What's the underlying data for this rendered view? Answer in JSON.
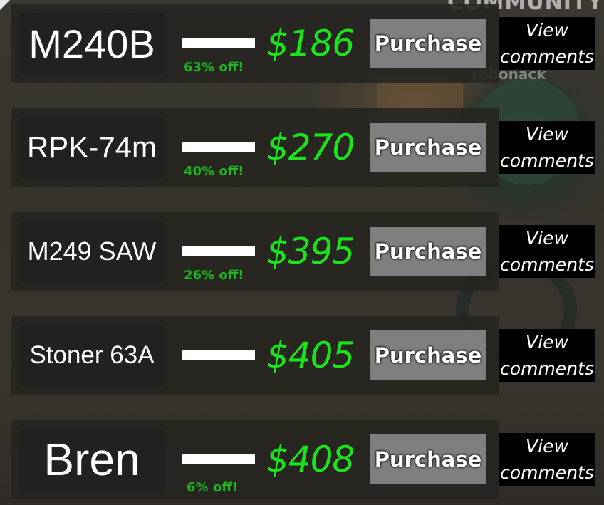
{
  "background": {
    "sign_text": "COMMUNITY",
    "sign_sub": "robonack"
  },
  "colors": {
    "price_green": "#19e619",
    "discount_green": "#22b022",
    "button_gray": "#7f7f7f"
  },
  "shop": {
    "items": [
      {
        "name": "M240B",
        "price": "$186",
        "discount": "63% off!",
        "purchase_label": "Purchase",
        "comments_line1": "View",
        "comments_line2": "comments"
      },
      {
        "name": "RPK-74m",
        "price": "$270",
        "discount": "40% off!",
        "purchase_label": "Purchase",
        "comments_line1": "View",
        "comments_line2": "comments"
      },
      {
        "name": "M249 SAW",
        "price": "$395",
        "discount": "26% off!",
        "purchase_label": "Purchase",
        "comments_line1": "View",
        "comments_line2": "comments"
      },
      {
        "name": "Stoner 63A",
        "price": "$405",
        "discount": "",
        "purchase_label": "Purchase",
        "comments_line1": "View",
        "comments_line2": "comments"
      },
      {
        "name": "Bren",
        "price": "$408",
        "discount": "6% off!",
        "purchase_label": "Purchase",
        "comments_line1": "View",
        "comments_line2": "comments"
      }
    ]
  }
}
